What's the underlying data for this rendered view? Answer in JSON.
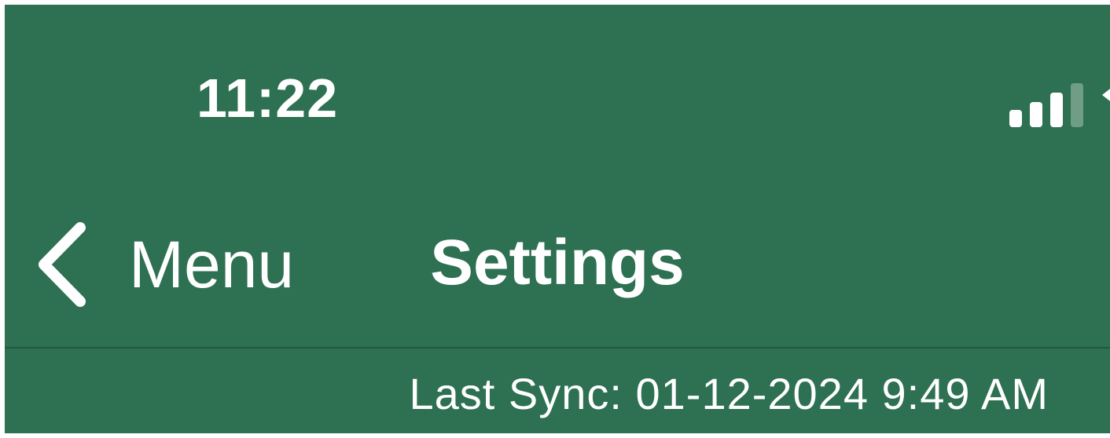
{
  "status_bar": {
    "time": "11:22",
    "signal_icon": "cellular-signal-icon",
    "signal_bars_active": 3,
    "signal_bars_total": 4,
    "wifi_icon": "wifi-icon"
  },
  "nav": {
    "back_icon": "chevron-left-icon",
    "back_label": "Menu",
    "title": "Settings"
  },
  "sync": {
    "label": "Last Sync: 01-12-2024 9:49 AM"
  },
  "colors": {
    "header_bg": "#2e7052",
    "text": "#ffffff",
    "divider": "#24573f",
    "signal_inactive": "#6f9d86"
  }
}
